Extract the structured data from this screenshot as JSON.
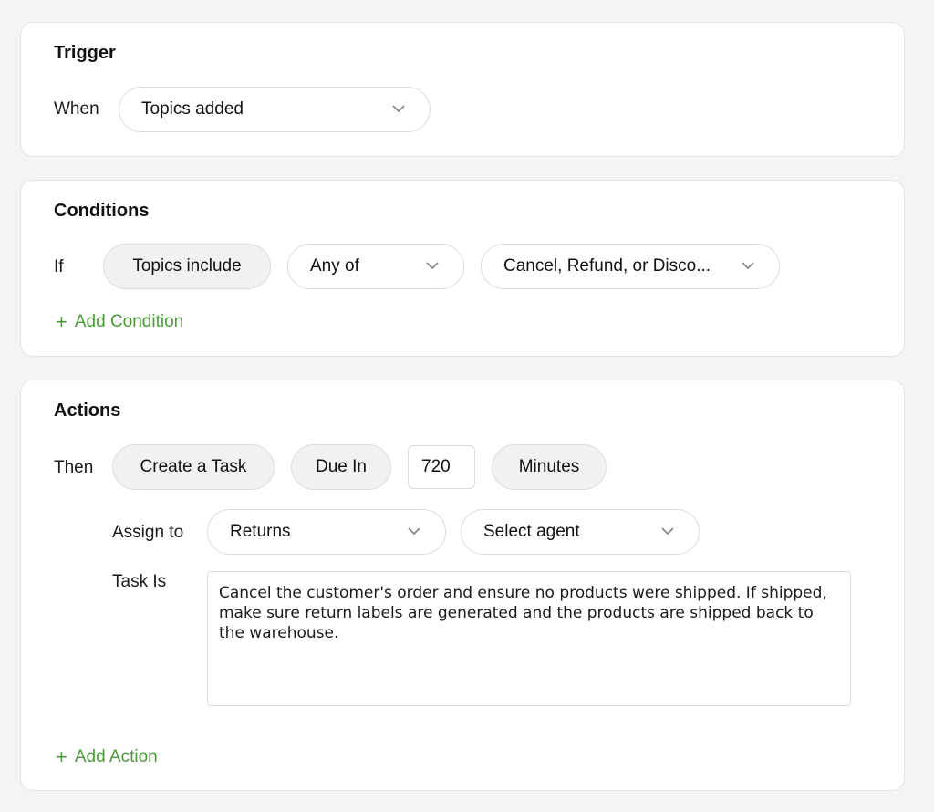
{
  "trigger": {
    "title": "Trigger",
    "when_label": "When",
    "event_select": "Topics added"
  },
  "conditions": {
    "title": "Conditions",
    "if_label": "If",
    "field_chip": "Topics include",
    "operator_select": "Any of",
    "value_select": "Cancel, Refund, or Disco...",
    "add_label": "Add Condition"
  },
  "actions": {
    "title": "Actions",
    "then_label": "Then",
    "action_chip": "Create a Task",
    "due_chip": "Due In",
    "due_value": "720",
    "unit_chip": "Minutes",
    "assign_label": "Assign to",
    "team_select": "Returns",
    "agent_select": "Select agent",
    "task_label": "Task Is",
    "task_text": "Cancel the customer's order and ensure no products were shipped. If shipped, make sure return labels are generated and the products are shipped back to the warehouse.",
    "add_label": "Add Action"
  },
  "colors": {
    "accent": "#4a9a3a",
    "background": "#f4f4f4",
    "chip": "#f1f1f1"
  }
}
